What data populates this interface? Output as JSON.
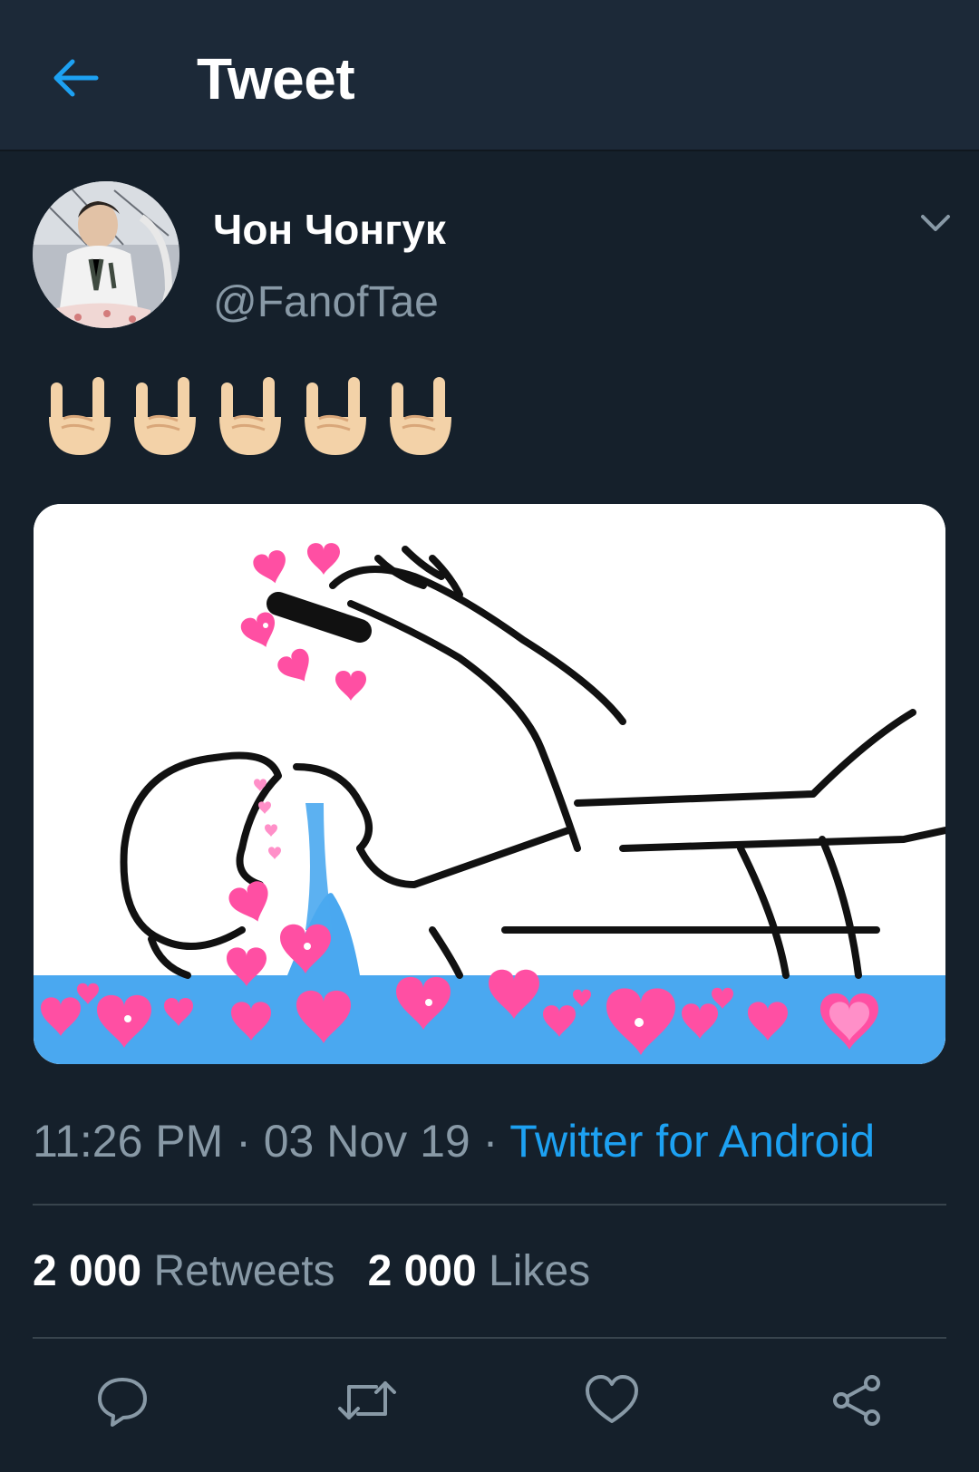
{
  "header": {
    "title": "Tweet",
    "back_icon": "arrow-left-icon",
    "accent": "#1da1f2"
  },
  "tweet": {
    "author": {
      "name": "Чон Чонгук",
      "handle": "@FanofTae",
      "avatar": "user-avatar-photo"
    },
    "text_emoji": [
      "sign-of-horns-icon",
      "sign-of-horns-icon",
      "sign-of-horns-icon",
      "sign-of-horns-icon",
      "sign-of-horns-icon"
    ],
    "media": "meme-image-with-pink-hearts",
    "time": "11:26 PM",
    "sep1": " · ",
    "date": "03 Nov 19",
    "sep2": " · ",
    "source": "Twitter for Android",
    "retweets_count": "2 000",
    "retweets_label": "Retweets",
    "likes_count": "2 000",
    "likes_label": "Likes"
  },
  "actions": [
    "reply-icon",
    "retweet-icon",
    "like-icon",
    "share-icon"
  ],
  "colors": {
    "background": "#15202b",
    "header": "#1c2938",
    "secondary_text": "#8899a6",
    "link": "#1da1f2",
    "divider": "#38444d"
  }
}
